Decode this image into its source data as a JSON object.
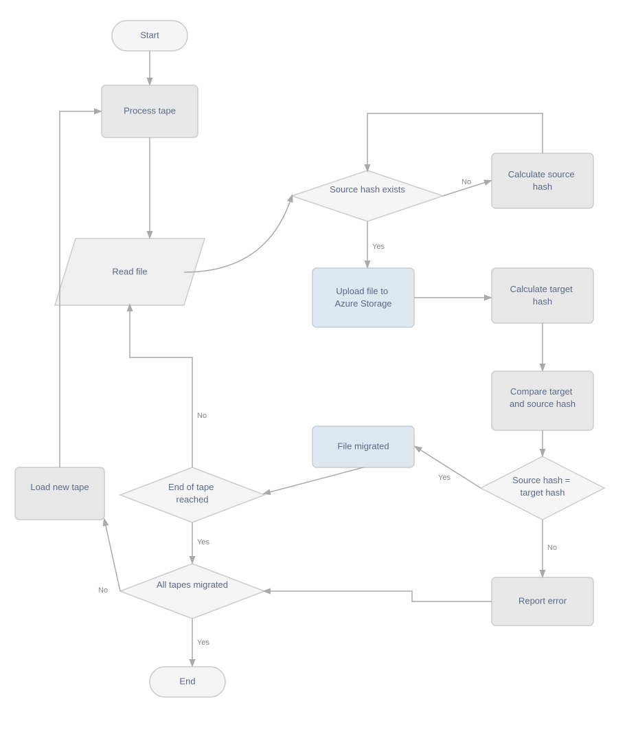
{
  "nodes": {
    "start": {
      "label": "Start"
    },
    "process_tape": {
      "label": "Process tape"
    },
    "read_file": {
      "label": "Read file"
    },
    "source_hash_exists": {
      "label": "Source hash exists"
    },
    "calculate_source_hash": {
      "label": "Calculate source hash"
    },
    "upload_file": {
      "label": "Upload file to Azure Storage"
    },
    "calculate_target_hash": {
      "label": "Calculate target hash"
    },
    "compare_hash": {
      "label": "Compare target and source hash"
    },
    "source_eq_target": {
      "label": "Source hash = target hash"
    },
    "file_migrated": {
      "label": "File migrated"
    },
    "end_of_tape": {
      "label": "End of tape reached"
    },
    "all_tapes_migrated": {
      "label": "All tapes migrated"
    },
    "load_new_tape": {
      "label": "Load new tape"
    },
    "report_error": {
      "label": "Report error"
    },
    "end": {
      "label": "End"
    }
  },
  "edge_labels": {
    "yes": "Yes",
    "no": "No"
  }
}
